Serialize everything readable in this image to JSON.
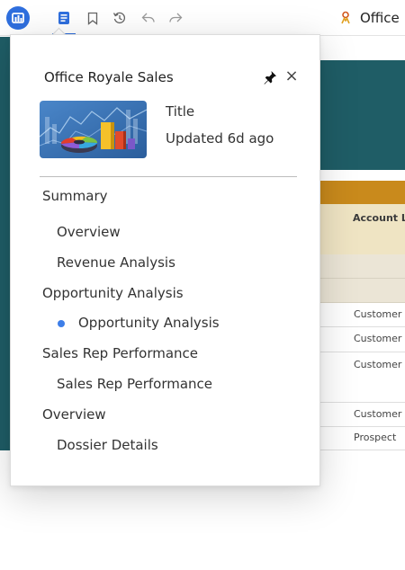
{
  "toolbar": {
    "dossier_title": "Office",
    "icons": [
      "app-logo-icon",
      "toc-icon",
      "bookmark-icon",
      "reset-icon",
      "undo-icon",
      "redo-icon",
      "person-icon"
    ]
  },
  "background": {
    "column_header": "Account Le",
    "rows": [
      "Customer",
      "Customer",
      "Customer",
      "Customer",
      "Prospect"
    ]
  },
  "toc": {
    "title": "Office Royale Sales",
    "meta_title": "Title",
    "updated": "Updated 6d ago",
    "chapters": [
      {
        "label": "Summary",
        "pages": [
          "Overview",
          "Revenue Analysis"
        ]
      },
      {
        "label": "Opportunity Analysis",
        "pages": [
          "Opportunity Analysis"
        ]
      },
      {
        "label": "Sales Rep Performance",
        "pages": [
          "Sales Rep Performance"
        ]
      },
      {
        "label": "Overview",
        "pages": [
          "Dossier Details"
        ]
      }
    ],
    "current_page": "Opportunity Analysis"
  },
  "colors": {
    "accent": "#2f6fde",
    "teal": "#1f5d66",
    "orange": "#c98a1c",
    "current_dot": "#3d7ee8"
  }
}
